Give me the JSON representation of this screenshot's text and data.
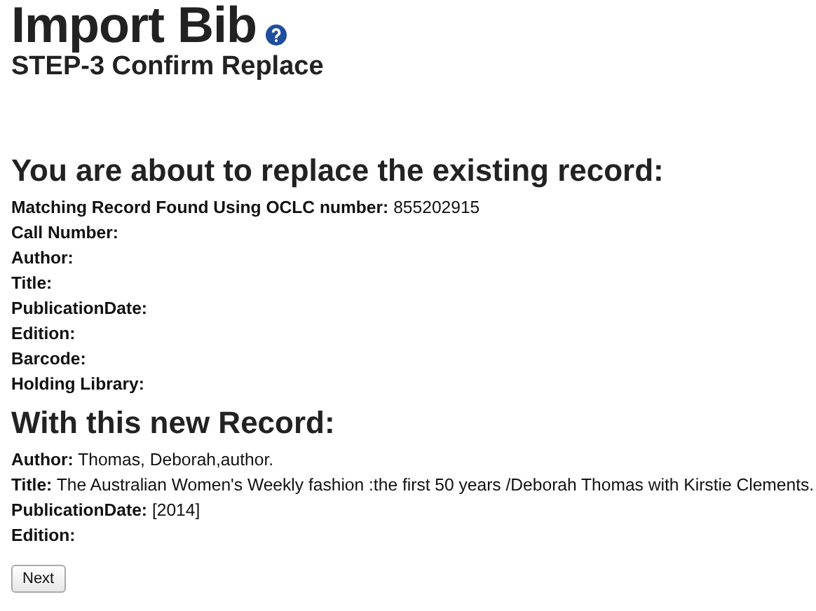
{
  "title": "Import Bib",
  "subtitle": "STEP-3 Confirm Replace",
  "existing": {
    "heading": "You are about to replace the existing record:",
    "fields": [
      {
        "label": "Matching Record Found Using OCLC number:",
        "value": "855202915"
      },
      {
        "label": "Call Number:"
      },
      {
        "label": "Author:"
      },
      {
        "label": "Title:"
      },
      {
        "label": "PublicationDate:"
      },
      {
        "label": "Edition:"
      },
      {
        "label": "Barcode:"
      },
      {
        "label": "Holding Library:"
      }
    ]
  },
  "incoming": {
    "heading": "With this new Record:",
    "fields": [
      {
        "label": "Author:",
        "value": "Thomas, Deborah,author."
      },
      {
        "label": "Title:",
        "value": "The Australian Women's Weekly fashion :the first 50 years /Deborah Thomas with Kirstie Clements."
      },
      {
        "label": "PublicationDate:",
        "value": "[2014]"
      },
      {
        "label": "Edition:"
      }
    ]
  },
  "button": "Next"
}
